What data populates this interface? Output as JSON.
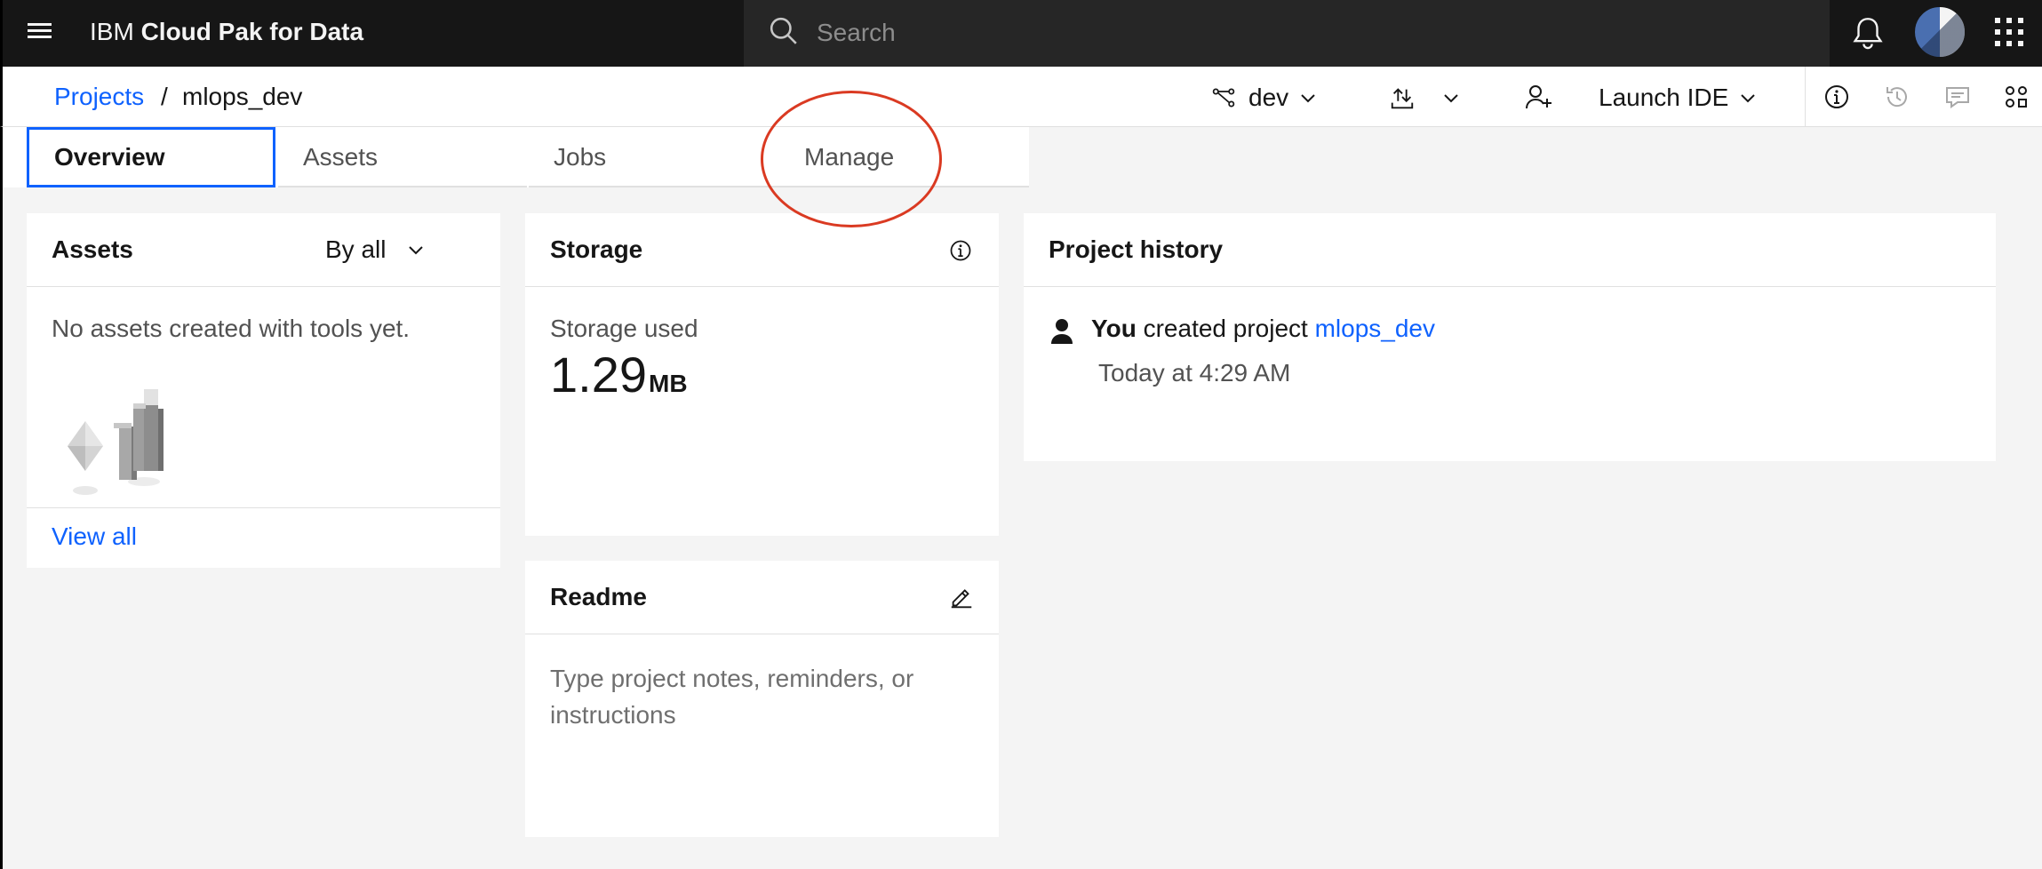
{
  "header": {
    "brand_prefix": "IBM",
    "brand_name": "Cloud Pak for Data",
    "search_placeholder": "Search"
  },
  "project_bar": {
    "breadcrumb_root": "Projects",
    "breadcrumb_separator": "/",
    "project_name": "mlops_dev",
    "branch_label": "dev",
    "launch_ide_label": "Launch IDE"
  },
  "tabs": [
    {
      "label": "Overview",
      "active": true
    },
    {
      "label": "Assets",
      "active": false
    },
    {
      "label": "Jobs",
      "active": false
    },
    {
      "label": "Manage",
      "active": false
    }
  ],
  "assets_card": {
    "title": "Assets",
    "filter_label": "By all",
    "empty_text": "No assets created with tools yet.",
    "view_all": "View all"
  },
  "storage_card": {
    "title": "Storage",
    "used_label": "Storage used",
    "used_value": "1.29",
    "used_unit": "MB"
  },
  "readme_card": {
    "title": "Readme",
    "placeholder": "Type project notes, reminders, or instructions"
  },
  "history_card": {
    "title": "Project history",
    "actor": "You",
    "action": "created project",
    "target": "mlops_dev",
    "time": "Today at 4:29 AM"
  },
  "colors": {
    "shell_bg": "#161616",
    "link": "#0f62fe",
    "annotation": "#da3a22",
    "canvas": "#f4f4f4"
  }
}
